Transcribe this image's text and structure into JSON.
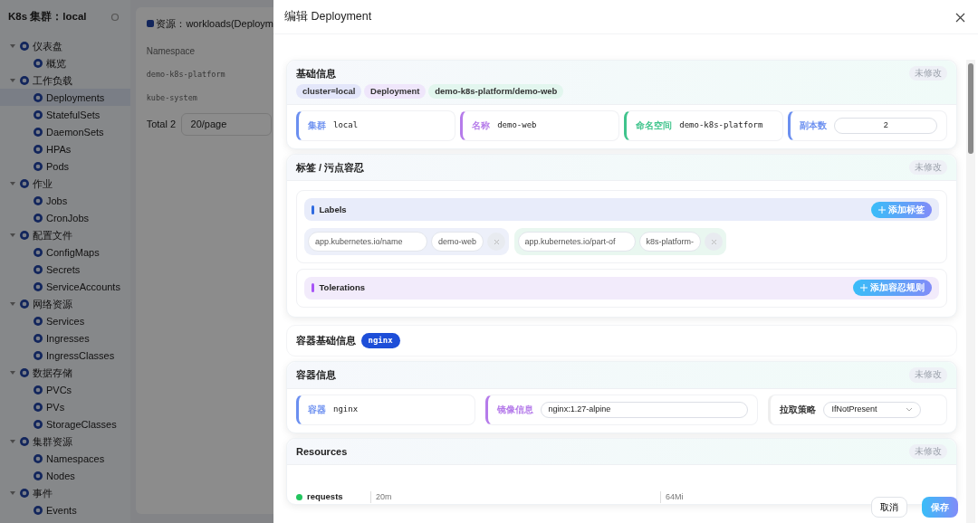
{
  "sidebar": {
    "title": "K8s 集群：local",
    "groups": [
      {
        "label": "仪表盘",
        "expanded": true,
        "selected": false,
        "children": [
          {
            "label": "概览",
            "selected": false
          }
        ]
      },
      {
        "label": "工作负载",
        "expanded": true,
        "selected": false,
        "children": [
          {
            "label": "Deployments",
            "selected": true
          },
          {
            "label": "StatefulSets",
            "selected": false
          },
          {
            "label": "DaemonSets",
            "selected": false
          },
          {
            "label": "HPAs",
            "selected": false
          },
          {
            "label": "Pods",
            "selected": false
          }
        ]
      },
      {
        "label": "作业",
        "expanded": true,
        "selected": false,
        "children": [
          {
            "label": "Jobs",
            "selected": false
          },
          {
            "label": "CronJobs",
            "selected": false
          }
        ]
      },
      {
        "label": "配置文件",
        "expanded": true,
        "selected": false,
        "children": [
          {
            "label": "ConfigMaps",
            "selected": false
          },
          {
            "label": "Secrets",
            "selected": false
          },
          {
            "label": "ServiceAccounts",
            "selected": false
          }
        ]
      },
      {
        "label": "网络资源",
        "expanded": true,
        "selected": false,
        "children": [
          {
            "label": "Services",
            "selected": false
          },
          {
            "label": "Ingresses",
            "selected": false
          },
          {
            "label": "IngressClasses",
            "selected": false
          }
        ]
      },
      {
        "label": "数据存储",
        "expanded": true,
        "selected": false,
        "children": [
          {
            "label": "PVCs",
            "selected": false
          },
          {
            "label": "PVs",
            "selected": false
          },
          {
            "label": "StorageClasses",
            "selected": false
          }
        ]
      },
      {
        "label": "集群资源",
        "expanded": true,
        "selected": false,
        "children": [
          {
            "label": "Namespaces",
            "selected": false
          },
          {
            "label": "Nodes",
            "selected": false
          }
        ]
      },
      {
        "label": "事件",
        "expanded": true,
        "selected": false,
        "children": [
          {
            "label": "Events",
            "selected": false
          }
        ]
      }
    ]
  },
  "background": {
    "resource_label": "资源：workloads(Deploym",
    "table": {
      "columns": [
        "Namespace"
      ],
      "rows": [
        [
          "demo-k8s-platform"
        ],
        [
          "kube-system"
        ]
      ]
    },
    "total": "Total 2",
    "page_size": "20/page"
  },
  "drawer": {
    "title": "编辑 Deployment",
    "basic": {
      "title": "基础信息",
      "status": "未修改",
      "tags": [
        {
          "text": "cluster=local",
          "color": "#e3e6fa"
        },
        {
          "text": "Deployment",
          "color": "#efe6fb"
        },
        {
          "text": "demo-k8s-platform/demo-web",
          "color": "#e2f6ee"
        }
      ],
      "fields": [
        {
          "kind": "text",
          "label": "集群",
          "value": "local",
          "color": "#6b8ff0"
        },
        {
          "kind": "text",
          "label": "名称",
          "value": "demo-web",
          "color": "#b57bea"
        },
        {
          "kind": "text",
          "label": "命名空间",
          "value": "demo-k8s-platform",
          "color": "#3fc48c"
        },
        {
          "kind": "input",
          "label": "副本数",
          "value": "2",
          "color": "#6b8ff0"
        }
      ]
    },
    "labels_tolerations": {
      "title": "标签 / 污点容忍",
      "status": "未修改",
      "labels": {
        "title": "Labels",
        "button": "添加标签",
        "pairs": [
          {
            "key": "app.kubernetes.io/name",
            "value": "demo-web",
            "color": "#edf0fa"
          },
          {
            "key": "app.kubernetes.io/part-of",
            "value": "k8s-platform-",
            "color": "#e9f7f0"
          }
        ]
      },
      "tolerations": {
        "title": "Tolerations",
        "button": "添加容忍规则"
      }
    },
    "container_basic": {
      "title": "容器基础信息",
      "badge": "nginx"
    },
    "container_info": {
      "title": "容器信息",
      "status": "未修改",
      "fields": [
        {
          "kind": "text",
          "label": "容器",
          "value": "nginx",
          "color": "#6b8ff0"
        },
        {
          "kind": "input",
          "label": "镜像信息",
          "value": "nginx:1.27-alpine",
          "color": "#b57bea"
        },
        {
          "kind": "select",
          "label": "拉取策略",
          "value": "IfNotPresent",
          "color": "#eeeeee"
        }
      ]
    },
    "resources": {
      "title": "Resources",
      "status": "未修改",
      "rows": [
        {
          "name": "requests",
          "color": "#22c55e",
          "cpu": "20m",
          "memory": "64Mi"
        }
      ]
    },
    "footer": {
      "cancel": "取消",
      "save": "保存"
    }
  }
}
